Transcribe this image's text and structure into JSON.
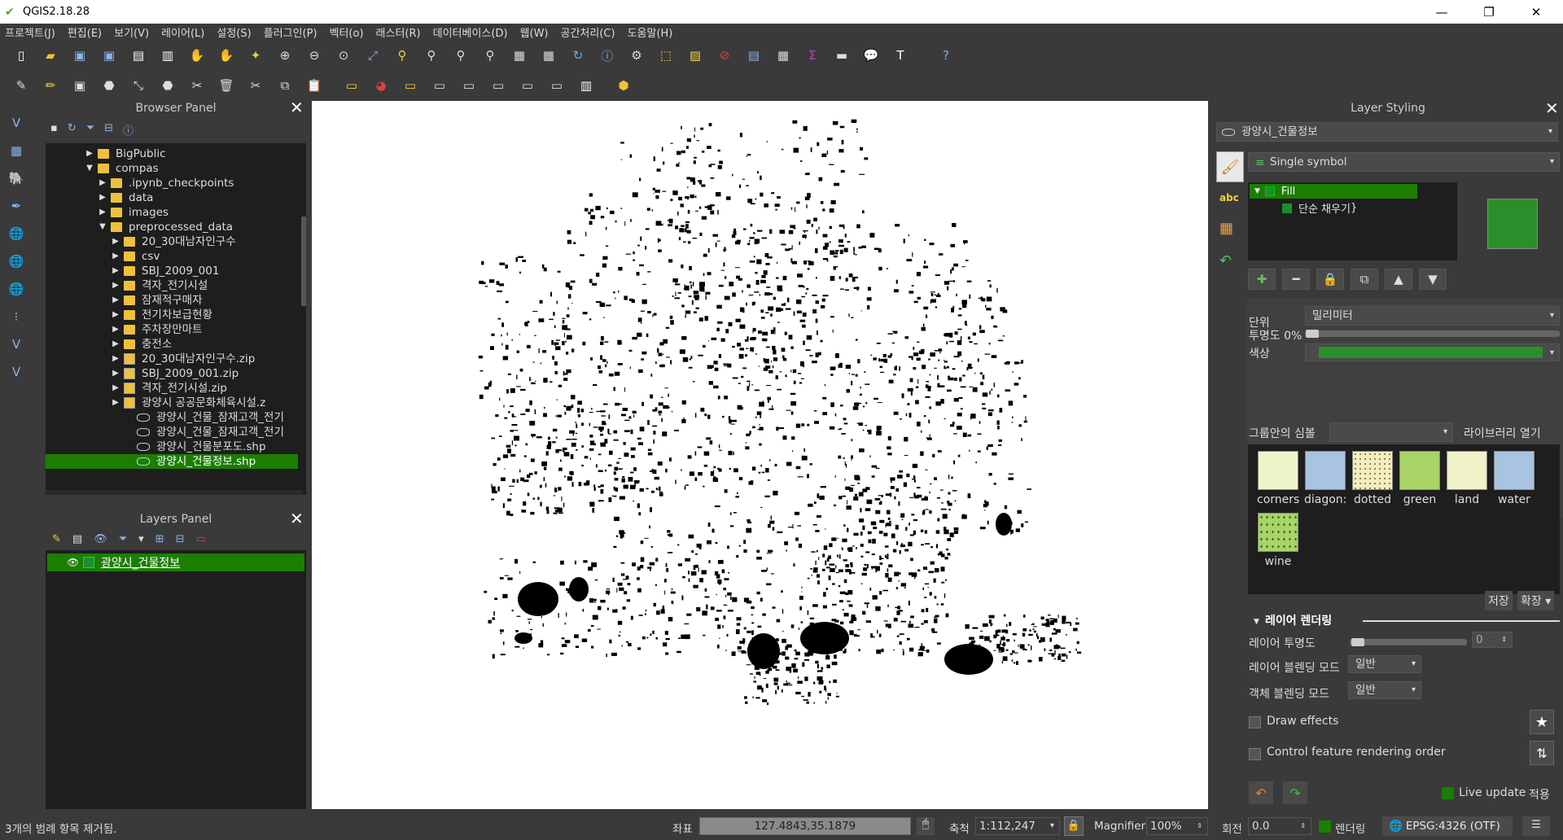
{
  "window": {
    "title": "QGIS2.18.28"
  },
  "menu": [
    "프로젝트(J)",
    "편집(E)",
    "보기(V)",
    "레이어(L)",
    "설정(S)",
    "플러그인(P)",
    "벡터(o)",
    "래스터(R)",
    "데이터베이스(D)",
    "웹(W)",
    "공간처리(C)",
    "도움말(H)"
  ],
  "browser": {
    "title": "Browser Panel",
    "items": [
      {
        "label": "BigPublic",
        "type": "folder",
        "expanded": false
      },
      {
        "label": "compas",
        "type": "folder",
        "expanded": true
      },
      {
        "label": ".ipynb_checkpoints",
        "type": "folder",
        "expanded": false
      },
      {
        "label": "data",
        "type": "folder",
        "expanded": false
      },
      {
        "label": "images",
        "type": "folder",
        "expanded": false
      },
      {
        "label": "preprocessed_data",
        "type": "folder",
        "expanded": true
      },
      {
        "label": "20_30대남자인구수",
        "type": "folder",
        "expanded": false
      },
      {
        "label": "csv",
        "type": "folder",
        "expanded": false
      },
      {
        "label": "SBJ_2009_001",
        "type": "folder",
        "expanded": false
      },
      {
        "label": "격자_전기시설",
        "type": "folder",
        "expanded": false
      },
      {
        "label": "잠재적구매자",
        "type": "folder",
        "expanded": false
      },
      {
        "label": "전기차보급현황",
        "type": "folder",
        "expanded": false
      },
      {
        "label": "주차장만마트",
        "type": "folder",
        "expanded": false
      },
      {
        "label": "충전소",
        "type": "folder",
        "expanded": false
      },
      {
        "label": "20_30대남자인구수.zip",
        "type": "zip",
        "expanded": false
      },
      {
        "label": "SBJ_2009_001.zip",
        "type": "zip",
        "expanded": false
      },
      {
        "label": "격자_전기시설.zip",
        "type": "zip",
        "expanded": false
      },
      {
        "label": "광양시 공공문화체육시설.z",
        "type": "zip",
        "expanded": false
      },
      {
        "label": "광양시_건물_잠재고객_전기",
        "type": "shp"
      },
      {
        "label": "광양시_건물_잠재고객_전기",
        "type": "shp"
      },
      {
        "label": "광양시_건물분포도.shp",
        "type": "shp"
      },
      {
        "label": "광양시_건물정보.shp",
        "type": "shp",
        "selected": true
      }
    ]
  },
  "layers_panel": {
    "title": "Layers Panel",
    "layers": [
      {
        "label": "광양시_건물정보",
        "visible": true,
        "color": "#1a8f2e"
      }
    ]
  },
  "styling": {
    "title": "Layer Styling",
    "layer_combo": "광양시_건물정보",
    "renderer": "Single symbol",
    "tree": {
      "root": "Fill",
      "child": "단순 채우기"
    },
    "fill_color": "#2a8f2a",
    "unit_label": "단위",
    "unit_value": "밀리미터",
    "opacity_label": "투명도 0%",
    "color_label": "색상",
    "group_label": "그룹안의 심볼",
    "open_library": "라이브러리 열기",
    "library": [
      {
        "name": "corners",
        "color": "#eef5c8"
      },
      {
        "name": "diagon:",
        "color": "#a8c4e0"
      },
      {
        "name": "dotted",
        "color": "#f2eec0"
      },
      {
        "name": "green",
        "color": "#a8d468"
      },
      {
        "name": "land",
        "color": "#f0f2c8"
      },
      {
        "name": "water",
        "color": "#a8c4e0"
      },
      {
        "name": "wine",
        "color": "#a8d468"
      }
    ],
    "save": "저장",
    "advanced": "확장",
    "rendering_section": "레이어 렌더링",
    "layer_opacity_label": "레이어 투명도",
    "layer_opacity_value": "0",
    "layer_blend_label": "레이어 블렌딩 모드",
    "layer_blend_value": "일반",
    "feature_blend_label": "객체 블렌딩 모드",
    "feature_blend_value": "일반",
    "draw_effects": "Draw effects",
    "control_order": "Control feature rendering order",
    "live_update": "Live update",
    "apply": "적용"
  },
  "status": {
    "message": "3개의 범례 항목 제거됨.",
    "coord_label": "좌표",
    "coord_value": "127.4843,35.1879",
    "scale_label": "축척",
    "scale_value": "1:112,247",
    "magnifier_label": "Magnifier",
    "magnifier_value": "100%",
    "rotation_label": "회전",
    "rotation_value": "0.0",
    "render_label": "렌더링",
    "crs": "EPSG:4326 (OTF)"
  },
  "colors": {
    "selection": "#1b7e00",
    "panel_bg": "#3a3a3a",
    "tree_bg": "#1e1e1e"
  }
}
